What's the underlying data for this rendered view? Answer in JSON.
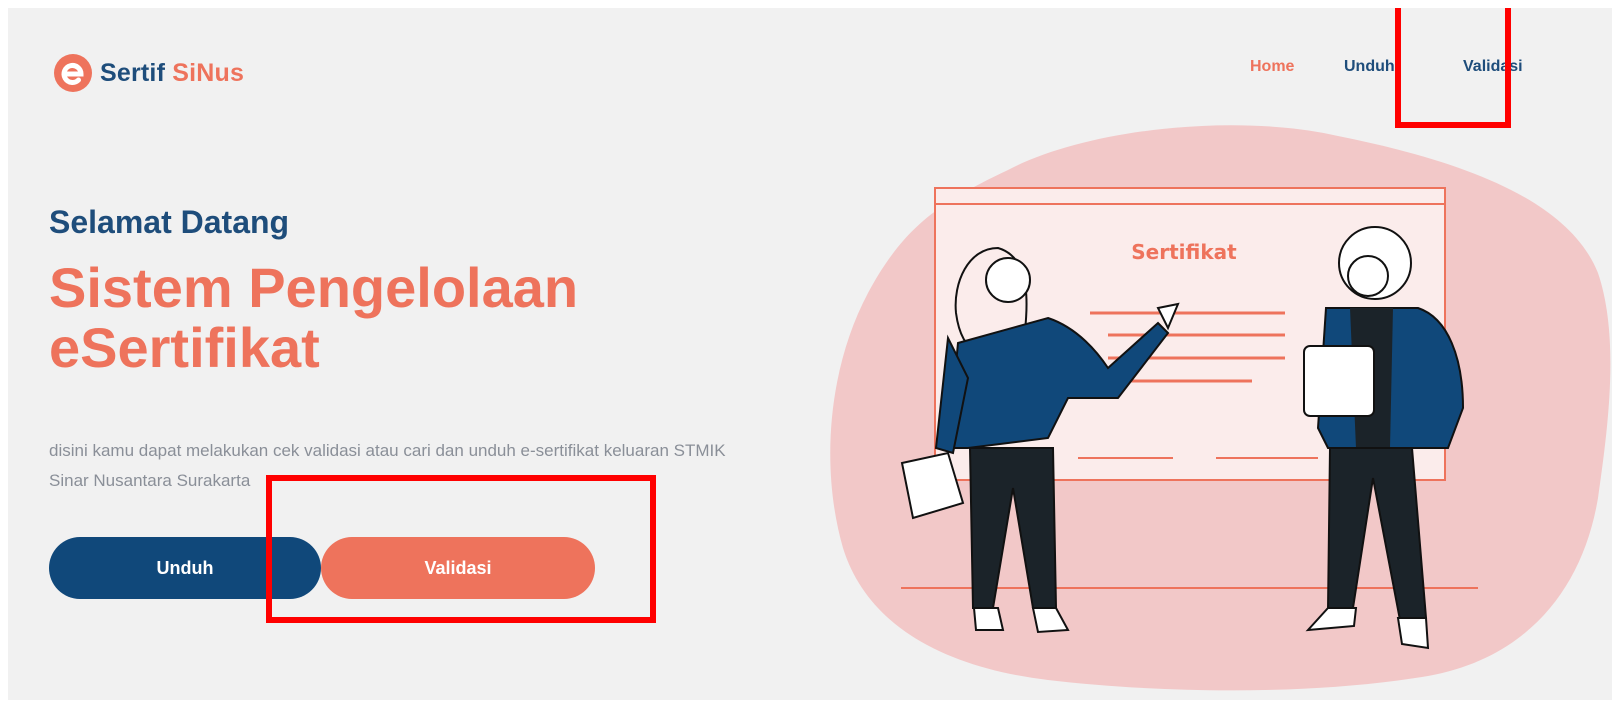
{
  "header": {
    "brand_part1": "Sertif",
    "brand_part2": "SiNus",
    "nav": [
      {
        "label": "Home",
        "active": true
      },
      {
        "label": "Unduh",
        "active": false
      },
      {
        "label": "Validasi",
        "active": false
      }
    ]
  },
  "hero": {
    "greeting": "Selamat Datang",
    "title_line1": "Sistem Pengelolaan",
    "title_line2": "eSertifikat",
    "description": "disini kamu dapat melakukan cek validasi atau cari dan unduh e-sertifikat keluaran STMIK Sinar Nusantara Surakarta",
    "button_download": "Unduh",
    "button_validate": "Validasi"
  },
  "illustration": {
    "board_title": "Sertifikat"
  },
  "colors": {
    "primary": "#10487a",
    "accent": "#ee735c",
    "background": "#f1f1f1",
    "blob": "#f2c8c8",
    "annotation": "#ff0000"
  }
}
